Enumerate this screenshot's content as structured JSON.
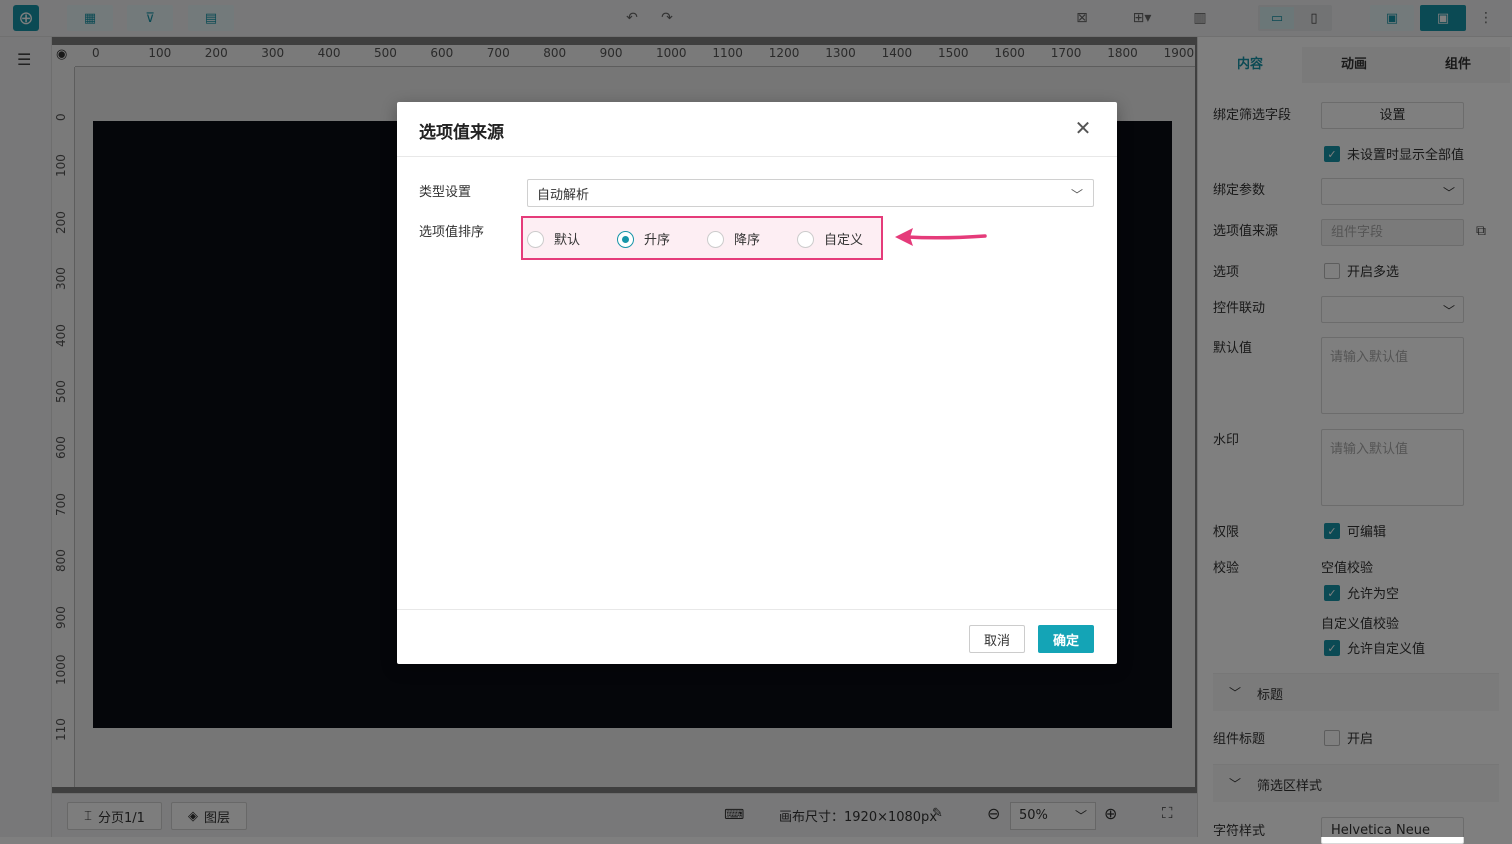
{
  "toolbar": {
    "icons": [
      "add-circle-icon",
      "add-table-icon",
      "add-filter-icon",
      "add-report-icon",
      "undo-icon",
      "redo-icon",
      "grid-icon",
      "align-icon",
      "layout-icon",
      "desktop-icon",
      "mobile-icon",
      "preview-icon",
      "save-icon",
      "more-icon"
    ]
  },
  "ruler": {
    "top_ticks": [
      "0",
      "100",
      "200",
      "300",
      "400",
      "500",
      "600",
      "700",
      "800",
      "900",
      "1000",
      "1100",
      "1200",
      "1300",
      "1400",
      "1500",
      "1600",
      "1700",
      "1800",
      "1900"
    ],
    "left_ticks": [
      "0",
      "100",
      "200",
      "300",
      "400",
      "500",
      "600",
      "700",
      "800",
      "900",
      "1000",
      "110"
    ]
  },
  "right_panel": {
    "tabs": [
      "内容",
      "动画",
      "组件"
    ],
    "bind_filter_label": "绑定筛选字段",
    "bind_filter_button": "设置",
    "show_all_label": "未设置时显示全部值",
    "bind_param_label": "绑定参数",
    "source_label": "选项值来源",
    "source_placeholder": "组件字段",
    "options_label": "选项",
    "multi_label": "开启多选",
    "linkage_label": "控件联动",
    "default_label": "默认值",
    "default_placeholder": "请输入默认值",
    "watermark_label": "水印",
    "watermark_placeholder": "请输入默认值",
    "permission_label": "权限",
    "editable_label": "可编辑",
    "validate_label": "校验",
    "empty_validate": "空值校验",
    "allow_empty": "允许为空",
    "custom_validate": "自定义值校验",
    "allow_custom": "允许自定义值",
    "section_title": "标题",
    "component_title_label": "组件标题",
    "component_title_open": "开启",
    "section_filter_style": "筛选区样式",
    "font_style_label": "字符样式",
    "font_value": "Helvetica Neue"
  },
  "bottom_bar": {
    "pages": "分页1/1",
    "layers": "图层",
    "canvas_size": "画布尺寸：1920×1080px",
    "zoom": "50%"
  },
  "dialog": {
    "title": "选项值来源",
    "type_label": "类型设置",
    "type_value": "自动解析",
    "sort_label": "选项值排序",
    "sort_options": [
      "默认",
      "升序",
      "降序",
      "自定义"
    ],
    "sort_selected": "升序",
    "cancel": "取消",
    "ok": "确定"
  },
  "colors": {
    "accent": "#1795a8",
    "highlight": "#e53b7a",
    "ok_button": "#14a4b6"
  }
}
